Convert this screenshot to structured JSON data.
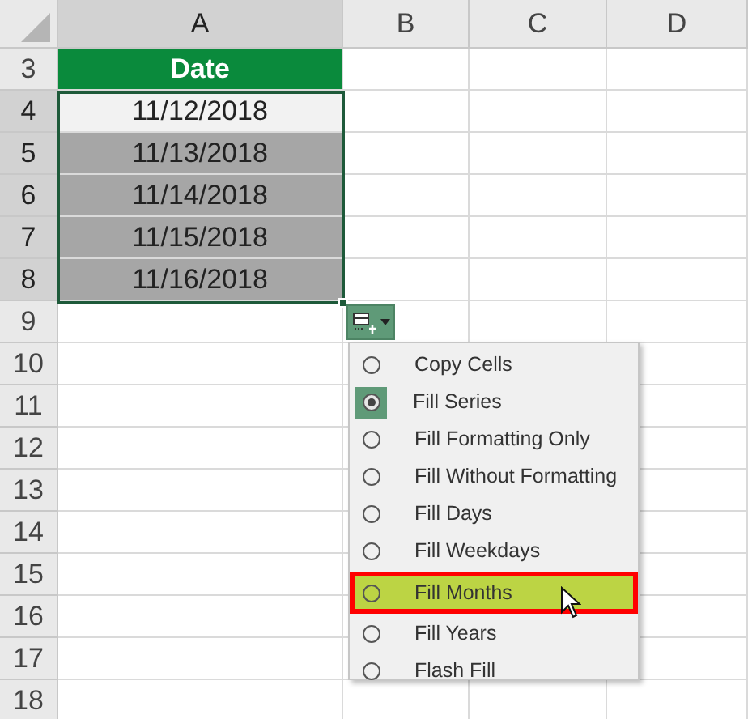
{
  "columns": [
    {
      "label": "A",
      "selected": true
    },
    {
      "label": "B",
      "selected": false
    },
    {
      "label": "C",
      "selected": false
    },
    {
      "label": "D",
      "selected": false
    }
  ],
  "rows": [
    {
      "number": "3",
      "selected": false,
      "cell": {
        "text": "Date",
        "kind": "header"
      }
    },
    {
      "number": "4",
      "selected": true,
      "cell": {
        "text": "11/12/2018",
        "kind": "active"
      }
    },
    {
      "number": "5",
      "selected": true,
      "cell": {
        "text": "11/13/2018",
        "kind": "selected"
      }
    },
    {
      "number": "6",
      "selected": true,
      "cell": {
        "text": "11/14/2018",
        "kind": "selected"
      }
    },
    {
      "number": "7",
      "selected": true,
      "cell": {
        "text": "11/15/2018",
        "kind": "selected"
      }
    },
    {
      "number": "8",
      "selected": true,
      "cell": {
        "text": "11/16/2018",
        "kind": "selected"
      }
    },
    {
      "number": "9",
      "selected": false
    },
    {
      "number": "10",
      "selected": false
    },
    {
      "number": "11",
      "selected": false
    },
    {
      "number": "12",
      "selected": false
    },
    {
      "number": "13",
      "selected": false
    },
    {
      "number": "14",
      "selected": false
    },
    {
      "number": "15",
      "selected": false
    },
    {
      "number": "16",
      "selected": false
    },
    {
      "number": "17",
      "selected": false
    },
    {
      "number": "18",
      "selected": false
    }
  ],
  "autofill_menu": {
    "items": [
      {
        "label": "Copy Cells",
        "selected": false,
        "highlighted": false
      },
      {
        "label": "Fill Series",
        "selected": true,
        "highlighted": false
      },
      {
        "label": "Fill Formatting Only",
        "selected": false,
        "highlighted": false
      },
      {
        "label": "Fill Without Formatting",
        "selected": false,
        "highlighted": false
      },
      {
        "label": "Fill Days",
        "selected": false,
        "highlighted": false
      },
      {
        "label": "Fill Weekdays",
        "selected": false,
        "highlighted": false
      },
      {
        "label": "Fill Months",
        "selected": false,
        "highlighted": true
      },
      {
        "label": "Fill Years",
        "selected": false,
        "highlighted": false
      },
      {
        "label": "Flash Fill",
        "selected": false,
        "highlighted": false
      }
    ]
  }
}
